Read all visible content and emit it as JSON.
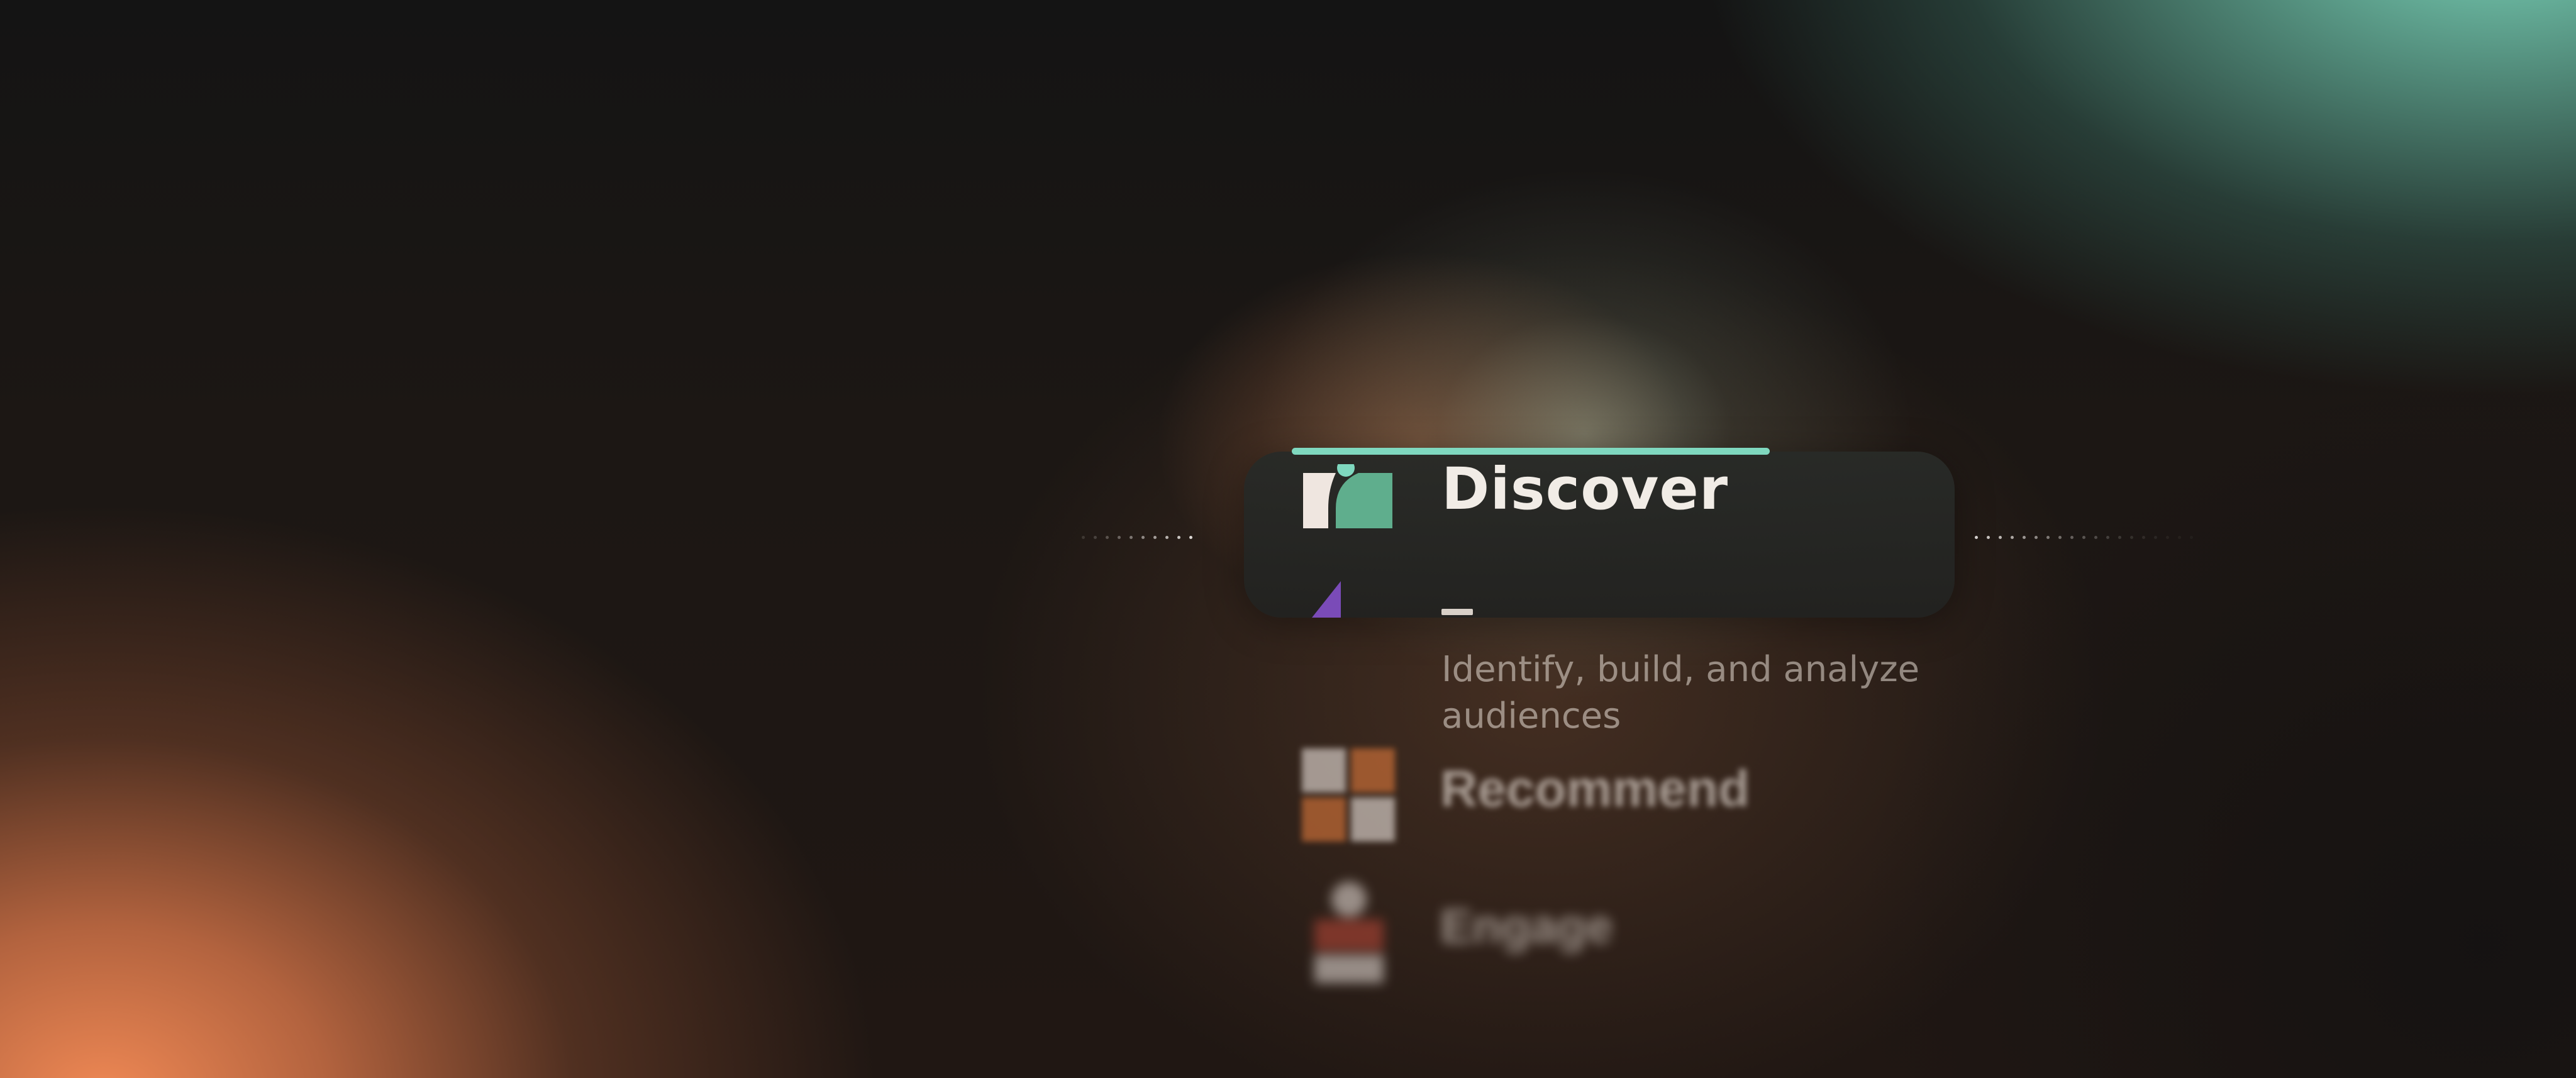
{
  "menu": {
    "active": {
      "title": "Discover",
      "progress": 0.67
    },
    "next_description": "Identify, build, and analyze audiences",
    "faded_items": [
      {
        "title": "Recommend",
        "icon": "grid-icon"
      },
      {
        "title": "Engage",
        "icon": "stack-icon"
      }
    ]
  },
  "colors": {
    "accent": "#7fd8bf",
    "discover_green": "#5fae8d",
    "icon_cream": "#efe6e0",
    "peek_purple": "#7a4bb8",
    "recommend_orange": "#e07a3c",
    "engage_red": "#c04a3a"
  }
}
